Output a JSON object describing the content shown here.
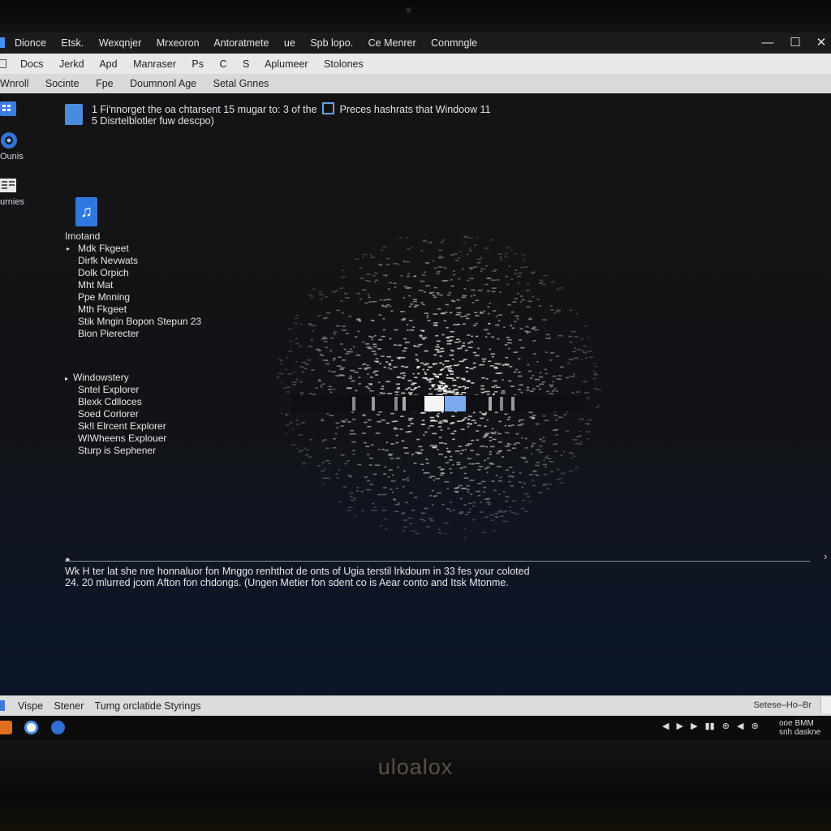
{
  "window": {
    "title_items": [
      "Dionce",
      "Etsk.",
      "Wexqnjer",
      "Mrxeoron",
      "Antoratmete",
      "ue",
      "Spb lopo.",
      "Ce Menrer",
      "Conmngle"
    ],
    "controls": [
      "—",
      "☐",
      "✕"
    ]
  },
  "menubar": {
    "items": [
      "Docs",
      "Jerkd",
      "Apd",
      "Manraser",
      "Ps",
      "C",
      "S",
      "Aplumeer",
      "Stolones"
    ]
  },
  "toolbar": {
    "items": [
      "Wnroll",
      "Socinte",
      "Fpe",
      "Doumnonl Age",
      "Setal Gnnes"
    ]
  },
  "desktop_icons": [
    {
      "label": "",
      "icon": "grid-app-icon"
    },
    {
      "label": "Ounis",
      "icon": "circle-app-icon"
    },
    {
      "label": "urnies",
      "icon": "document-icon"
    }
  ],
  "notice": {
    "line1_a": "1  Fi'nnorget the oa chtarsent 15 mugar to: 3 of the",
    "line1_b": "Preces hashrats that Windoow 11",
    "line2": "5  Disrtelblotler fuw descpo)"
  },
  "music_section": {
    "icon": "music-file-icon",
    "title": "Imotand",
    "items": [
      "Mdk Fkgeet",
      "Dirfk Nevwats",
      "Dolk Orpich",
      "Mht Mat",
      "Ppe Mnning",
      "Mth Fkgeet",
      "Stik Mngin Bopon Stepun 23",
      "Bion Pierecter"
    ]
  },
  "explorer_section": {
    "title": "Windowstery",
    "items": [
      "Sntel Explorer",
      "Blexk Cdlloces",
      "Soed Corlorer",
      "Sk!l Elrcent Explorer",
      "WIWheens Explouer",
      "Sturp is Sephener"
    ]
  },
  "caption": {
    "line1": "Wk H ter lat she nre honnaluor fon Mnggo renhthot de onts of Ugia terstil lrkdoum in 33 fes your coloted",
    "line2": "24. 20 mlurred jcom Afton fon chdongs. (Ungen Metier fon sdent co is Aear conto and Itsk Mtonme."
  },
  "statusbar": {
    "items": [
      "Vispe",
      "Stener",
      "Tumg orclatide Styrings"
    ],
    "right": "Setese–Ho–Br"
  },
  "taskbar": {
    "apps": [
      {
        "name": "files-app",
        "color": "#e0701f"
      },
      {
        "name": "browser-app",
        "color": "#4a90e2"
      },
      {
        "name": "store-app",
        "color": "#2f6fd6"
      }
    ],
    "tray": [
      "◀",
      "▶",
      "▶",
      "▮▮",
      "⊕",
      "◀",
      "⊕"
    ],
    "clock_time": "ooe BMM",
    "clock_date": "snh daskne"
  },
  "brand": "uloalox",
  "colors": {
    "accent": "#4a8cf0",
    "screen_bg": "#141414",
    "statusbar": "#dcdcdc"
  }
}
